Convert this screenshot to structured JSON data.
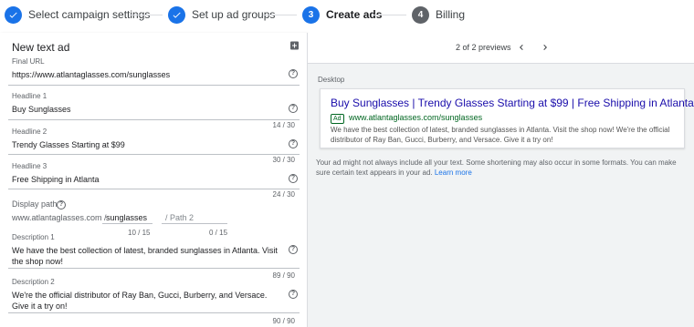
{
  "stepper": {
    "steps": [
      {
        "number": "",
        "label": "Select campaign settings",
        "state": "done"
      },
      {
        "number": "",
        "label": "Set up ad groups",
        "state": "done"
      },
      {
        "number": "3",
        "label": "Create ads",
        "state": "active"
      },
      {
        "number": "4",
        "label": "Billing",
        "state": "todo"
      }
    ]
  },
  "editor": {
    "title": "New text ad",
    "final_url": {
      "label": "Final URL",
      "value": "https://www.atlantaglasses.com/sunglasses"
    },
    "headline1": {
      "label": "Headline 1",
      "value": "Buy Sunglasses",
      "counter": "14 / 30"
    },
    "headline2": {
      "label": "Headline 2",
      "value": "Trendy Glasses Starting at $99",
      "counter": "30 / 30"
    },
    "headline3": {
      "label": "Headline 3",
      "value": "Free Shipping in Atlanta",
      "counter": "24 / 30"
    },
    "display_path": {
      "label": "Display path",
      "domain": "www.atlantaglasses.com /",
      "path1": "sunglasses",
      "path2_placeholder": "/ Path 2",
      "path1_counter": "10 / 15",
      "path2_counter": "0 / 15"
    },
    "description1": {
      "label": "Description 1",
      "value": "We have the best collection of latest, branded sunglasses in Atlanta. Visit the shop now!",
      "counter": "89 / 90"
    },
    "description2": {
      "label": "Description 2",
      "value": "We're the official distributor of Ray Ban, Gucci, Burberry, and Versace. Give it a try on!",
      "counter": "90 / 90"
    }
  },
  "preview": {
    "count_text": "2 of 2 previews",
    "device_label": "Desktop",
    "ad": {
      "headline": "Buy Sunglasses | Trendy Glasses Starting at $99 | Free Shipping in Atlanta",
      "badge": "Ad",
      "url": "www.atlantaglasses.com/sunglasses",
      "description": "We have the best collection of latest, branded sunglasses in Atlanta. Visit the shop now! We're the official distributor of Ray Ban, Gucci, Burberry, and Versace. Give it a try on!"
    },
    "note": "Your ad might not always include all your text. Some shortening may also occur in some formats. You can make sure certain text appears in your ad.",
    "learn_more": "Learn more"
  },
  "icons": {
    "check": "check-icon",
    "help": "help-icon",
    "add": "add-box-icon",
    "prev": "chevron-left-icon",
    "next": "chevron-right-icon"
  },
  "colors": {
    "accent": "#1a73e8",
    "ad_title": "#1a0dab",
    "ad_url": "#006621"
  }
}
